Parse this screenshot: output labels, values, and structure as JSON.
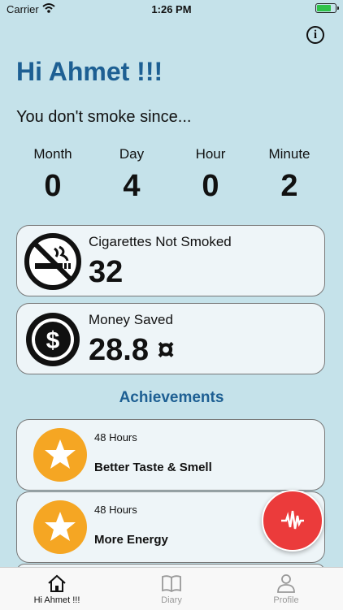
{
  "status_bar": {
    "carrier": "Carrier",
    "time": "1:26 PM"
  },
  "header": {
    "greeting": "Hi Ahmet !!!",
    "subtitle": "You don't smoke since..."
  },
  "counters": [
    {
      "label": "Month",
      "value": "0"
    },
    {
      "label": "Day",
      "value": "4"
    },
    {
      "label": "Hour",
      "value": "0"
    },
    {
      "label": "Minute",
      "value": "2"
    }
  ],
  "stats": {
    "cigarettes": {
      "title": "Cigarettes Not Smoked",
      "value": "32",
      "icon": "no-smoking-icon"
    },
    "money": {
      "title": "Money Saved",
      "value": "28.8 ¤",
      "icon": "dollar-icon"
    }
  },
  "achievements": {
    "title": "Achievements",
    "items": [
      {
        "duration": "48 Hours",
        "name": "Better Taste & Smell",
        "icon": "star-icon"
      },
      {
        "duration": "48 Hours",
        "name": "More Energy",
        "icon": "star-icon"
      }
    ]
  },
  "tabs": [
    {
      "label": "Hi Ahmet !!!",
      "icon": "home-icon",
      "active": true
    },
    {
      "label": "Diary",
      "icon": "book-icon",
      "active": false
    },
    {
      "label": "Profile",
      "icon": "person-icon",
      "active": false
    }
  ],
  "colors": {
    "background": "#c5e2ea",
    "accent": "#1d5f93",
    "fab": "#eb3b3b",
    "star": "#f5a623"
  }
}
